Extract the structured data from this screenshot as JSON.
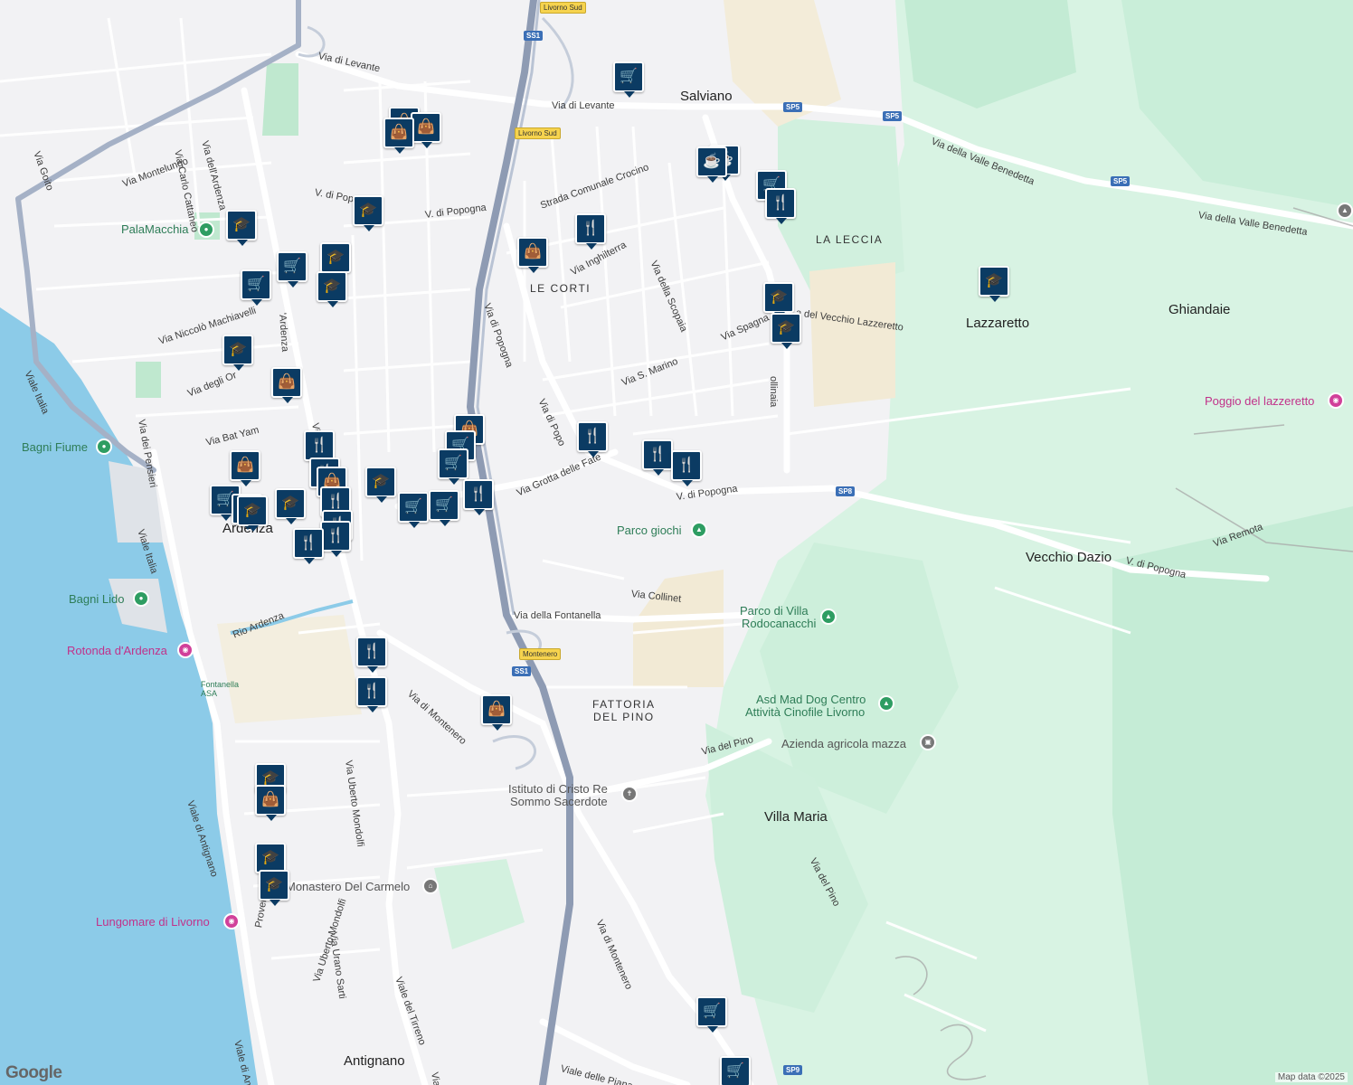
{
  "places": [
    {
      "id": "salviano",
      "text": "Salviano"
    },
    {
      "id": "lazzaretto",
      "text": "Lazzaretto"
    },
    {
      "id": "ghiandaie",
      "text": "Ghiandaie"
    },
    {
      "id": "vecchio-dazio",
      "text": "Vecchio Dazio"
    },
    {
      "id": "ardenza",
      "text": "Ardenza"
    },
    {
      "id": "villa-maria",
      "text": "Villa Maria"
    },
    {
      "id": "antignano",
      "text": "Antignano"
    }
  ],
  "districts": [
    {
      "id": "la-leccia",
      "text": "LA LECCIA"
    },
    {
      "id": "le-corti",
      "text": "LE CORTI"
    },
    {
      "id": "fattoria-1",
      "text": "FATTORIA"
    },
    {
      "id": "fattoria-2",
      "text": "DEL PINO"
    }
  ],
  "streets": [
    {
      "id": "s1",
      "text": "Via di Levante"
    },
    {
      "id": "s2",
      "text": "Via di Levante"
    },
    {
      "id": "s3",
      "text": "Via della Valle Benedetta"
    },
    {
      "id": "s4",
      "text": "Via della Valle Benedetta"
    },
    {
      "id": "s5",
      "text": "Strada Comunale Crocino"
    },
    {
      "id": "s6",
      "text": "V. di Popogna"
    },
    {
      "id": "s7",
      "text": "V. di Popogna"
    },
    {
      "id": "s8",
      "text": "V. di Popogna"
    },
    {
      "id": "s9",
      "text": "V. di Popogna"
    },
    {
      "id": "s10",
      "text": "Via di Popogna"
    },
    {
      "id": "s11",
      "text": "Via di Popo"
    },
    {
      "id": "s12",
      "text": "Via Inghilterra"
    },
    {
      "id": "s13",
      "text": "Via della Scopaia"
    },
    {
      "id": "s14",
      "text": "Via S. Marino"
    },
    {
      "id": "s15",
      "text": "Via Spagna"
    },
    {
      "id": "s16",
      "text": "a del Vecchio Lazzeretto"
    },
    {
      "id": "s17",
      "text": "ollinaia"
    },
    {
      "id": "s18",
      "text": "Via Grotta delle Fate"
    },
    {
      "id": "s19",
      "text": "Via Collinet"
    },
    {
      "id": "s20",
      "text": "Via della Fontanella"
    },
    {
      "id": "s21",
      "text": "Via di Montenero"
    },
    {
      "id": "s22",
      "text": "Via di Montenero"
    },
    {
      "id": "s23",
      "text": "Via del Pino"
    },
    {
      "id": "s24",
      "text": "Via del Pino"
    },
    {
      "id": "s25",
      "text": "Via Remota"
    },
    {
      "id": "s26",
      "text": "Via Goito"
    },
    {
      "id": "s27",
      "text": "Via Carlo Cattaneo"
    },
    {
      "id": "s28",
      "text": "Via dell'Ardenza"
    },
    {
      "id": "s29",
      "text": "Via Montelungo"
    },
    {
      "id": "s30",
      "text": "Via Niccolò Machiavelli"
    },
    {
      "id": "s31",
      "text": "Via degli Or"
    },
    {
      "id": "s32",
      "text": "Via dei Pensieri"
    },
    {
      "id": "s33",
      "text": "Via Bat Yam"
    },
    {
      "id": "s34",
      "text": "Viale Italia"
    },
    {
      "id": "s35",
      "text": "Viale Italia"
    },
    {
      "id": "s36",
      "text": "Rio Ardenza"
    },
    {
      "id": "s37",
      "text": "Viale di Antignano"
    },
    {
      "id": "s38",
      "text": "Viale di Antignano"
    },
    {
      "id": "s39",
      "text": "Via Uberto Mondolfi"
    },
    {
      "id": "s40",
      "text": "Via Uberto Mondolfi"
    },
    {
      "id": "s41",
      "text": "Viale del Tirreno"
    },
    {
      "id": "s42",
      "text": "Via Urano Sarti"
    },
    {
      "id": "s43",
      "text": "Provenzal"
    },
    {
      "id": "s44",
      "text": "Viale delle Piana"
    },
    {
      "id": "s45",
      "text": "Viale del"
    },
    {
      "id": "s46",
      "text": "'Ardenza"
    },
    {
      "id": "s47",
      "text": "V. di Popo"
    },
    {
      "id": "s48",
      "text": "Via"
    }
  ],
  "shields": [
    {
      "id": "ss1-a",
      "text": "SS1",
      "kind": "blue"
    },
    {
      "id": "ss1-b",
      "text": "SS1",
      "kind": "blue"
    },
    {
      "id": "sp5-a",
      "text": "SP5",
      "kind": "blue"
    },
    {
      "id": "sp5-b",
      "text": "SP5",
      "kind": "blue"
    },
    {
      "id": "sp5-c",
      "text": "SP5",
      "kind": "blue"
    },
    {
      "id": "sp8",
      "text": "SP8",
      "kind": "blue"
    },
    {
      "id": "sp9",
      "text": "SP9",
      "kind": "blue"
    },
    {
      "id": "exit-livorno-sud-a",
      "text": "Livorno Sud",
      "kind": "yellow"
    },
    {
      "id": "exit-livorno-sud-b",
      "text": "Livorno Sud",
      "kind": "yellow"
    },
    {
      "id": "exit-montenero",
      "text": "Montenero",
      "kind": "yellow"
    }
  ],
  "pois": [
    {
      "id": "palamacchia",
      "text": "PalaMacchia",
      "color": "#2e7d57",
      "icon": "sports-icon"
    },
    {
      "id": "bagni-fiume",
      "text": "Bagni Fiume",
      "color": "#2e7d57",
      "icon": "beach-icon"
    },
    {
      "id": "bagni-lido",
      "text": "Bagni Lido",
      "color": "#2e7d57",
      "icon": "beach-icon"
    },
    {
      "id": "rotonda",
      "text": "Rotonda d'Ardenza",
      "color": "#c1328a",
      "icon": "camera-icon"
    },
    {
      "id": "lungomare",
      "text": "Lungomare di Livorno",
      "color": "#c1328a",
      "icon": "camera-icon"
    },
    {
      "id": "parco-giochi",
      "text": "Parco giochi",
      "color": "#2e7d57",
      "icon": "tree-icon"
    },
    {
      "id": "parco-villa-1",
      "text": "Parco di Villa",
      "color": "#2e7d57",
      "icon": "tree-icon"
    },
    {
      "id": "parco-villa-2",
      "text": "Rodocanacchi",
      "color": "#2e7d57",
      "icon": ""
    },
    {
      "id": "asd-1",
      "text": "Asd Mad Dog Centro",
      "color": "#2e7d57",
      "icon": "tree-icon"
    },
    {
      "id": "asd-2",
      "text": "Attività Cinofile Livorno",
      "color": "#2e7d57",
      "icon": ""
    },
    {
      "id": "azienda",
      "text": "Azienda agricola mazza",
      "color": "#555555",
      "icon": "building-icon"
    },
    {
      "id": "istituto-1",
      "text": "Istituto di Cristo Re",
      "color": "#555555",
      "icon": ""
    },
    {
      "id": "istituto-2",
      "text": "Sommo Sacerdote",
      "color": "#555555",
      "icon": "cross-icon"
    },
    {
      "id": "monastero",
      "text": "Monastero Del Carmelo",
      "color": "#555555",
      "icon": "museum-icon"
    },
    {
      "id": "poggio",
      "text": "Poggio del lazzeretto",
      "color": "#c1328a",
      "icon": "camera-icon"
    },
    {
      "id": "fontanella",
      "text": "Fontanella ASA",
      "color": "#2e7d57",
      "icon": ""
    }
  ],
  "markers": {
    "icons": {
      "shop": "shopping-bag-icon",
      "grocery": "shopping-cart-icon",
      "restaurant": "restaurant-icon",
      "school": "school-icon",
      "cafe": "coffee-icon"
    },
    "glyphs": {
      "shop": "👜",
      "grocery": "🛒",
      "restaurant": "🍴",
      "school": "🎓",
      "cafe": "☕"
    }
  },
  "footer": {
    "logo": "Google",
    "attribution": "Map data ©2025"
  },
  "colors": {
    "water": "#8ccbe8",
    "park": "#c7ecd7",
    "forest": "#d6f2e2",
    "sand": "#f3ecd9",
    "road": "#ffffff",
    "highway": "#8e9bb3",
    "marker": "#0b3b63"
  }
}
